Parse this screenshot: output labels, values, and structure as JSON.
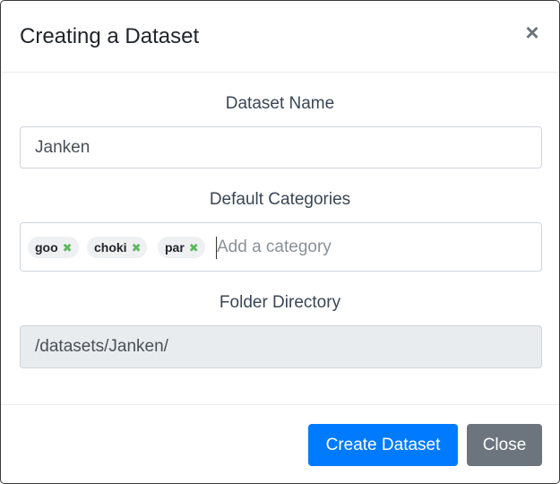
{
  "modal": {
    "title": "Creating a Dataset",
    "close_icon": "×"
  },
  "form": {
    "name_label": "Dataset Name",
    "name_value": "Janken",
    "categories_label": "Default Categories",
    "categories": [
      {
        "label": "goo"
      },
      {
        "label": "choki"
      },
      {
        "label": "par"
      }
    ],
    "tag_remove_icon": "✖",
    "category_placeholder": "Add a category",
    "folder_label": "Folder Directory",
    "folder_value": "/datasets/Janken/"
  },
  "footer": {
    "create_label": "Create Dataset",
    "close_label": "Close"
  },
  "colors": {
    "primary": "#007bff",
    "secondary": "#6c757d",
    "tag_remove": "#5cb85c"
  }
}
